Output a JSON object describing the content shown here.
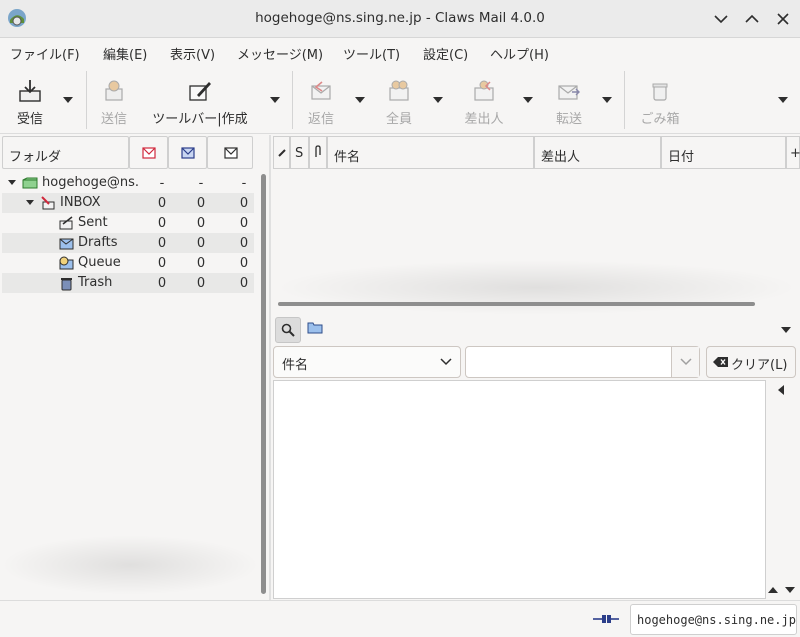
{
  "window": {
    "title": "hogehoge@ns.sing.ne.jp - Claws Mail 4.0.0"
  },
  "menu": [
    "ファイル(F)",
    "編集(E)",
    "表示(V)",
    "メッセージ(M)",
    "ツール(T)",
    "設定(C)",
    "ヘルプ(H)"
  ],
  "toolbar": {
    "receive": "受信",
    "send": "送信",
    "compose": "ツールバー|作成",
    "reply": "返信",
    "reply_all": "全員",
    "reply_sender": "差出人",
    "forward": "転送",
    "trash": "ごみ箱"
  },
  "folder_pane": {
    "header": "フォルダ",
    "folders": [
      {
        "name": "hogehoge@ns.",
        "new": "-",
        "unread": "-",
        "total": "-"
      },
      {
        "name": "INBOX",
        "new": "0",
        "unread": "0",
        "total": "0"
      },
      {
        "name": "Sent",
        "new": "0",
        "unread": "0",
        "total": "0"
      },
      {
        "name": "Drafts",
        "new": "0",
        "unread": "0",
        "total": "0"
      },
      {
        "name": "Queue",
        "new": "0",
        "unread": "0",
        "total": "0"
      },
      {
        "name": "Trash",
        "new": "0",
        "unread": "0",
        "total": "0"
      }
    ]
  },
  "message_list": {
    "col_status": "S",
    "col_subject": "件名",
    "col_from": "差出人",
    "col_date": "日付",
    "col_more": "+"
  },
  "quick_search": {
    "type_selected": "件名",
    "value": "",
    "clear": "クリア(L)"
  },
  "statusbar": {
    "account": "hogehoge@ns.sing.ne.jp"
  },
  "colors": {
    "accent": "#3a7bd5",
    "new_mail": "#d0283c",
    "folder_green": "#4aa24a"
  }
}
